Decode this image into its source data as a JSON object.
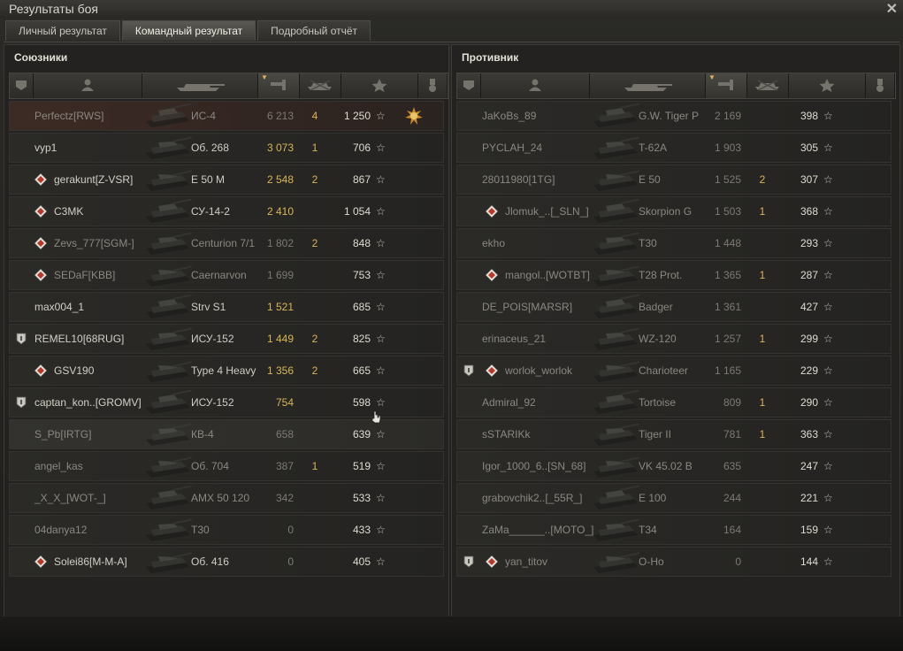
{
  "window": {
    "title": "Результаты боя"
  },
  "tabs": [
    {
      "label": "Личный результат",
      "active": false
    },
    {
      "label": "Командный результат",
      "active": true
    },
    {
      "label": "Подробный отчёт",
      "active": false
    }
  ],
  "icons": {
    "close": "close-icon",
    "header": [
      "platoon-icon",
      "player-icon",
      "tank-icon",
      "damage-icon",
      "kills-icon",
      "xp-icon",
      "medal-icon"
    ]
  },
  "colors": {
    "damage_highlight": "#d8b557",
    "self_row": "#3d2a24",
    "background": "#232220"
  },
  "allies": {
    "title": "Союзники",
    "rows": [
      {
        "name": "Perfectz[RWS]",
        "tank": "ИС-4",
        "damage": "6 213",
        "dmg_hi": false,
        "kills": "4",
        "xp": "1 250",
        "self": true,
        "dead": true,
        "platoon": false,
        "clan": false,
        "medal": true
      },
      {
        "name": "vyp1",
        "tank": "Об. 268",
        "damage": "3 073",
        "dmg_hi": true,
        "kills": "1",
        "xp": "706",
        "platoon": false,
        "clan": false
      },
      {
        "name": "gerakunt[Z-VSR]",
        "tank": "E 50 M",
        "damage": "2 548",
        "dmg_hi": true,
        "kills": "2",
        "xp": "867",
        "platoon": false,
        "clan": true
      },
      {
        "name": "C3MK",
        "tank": "СУ-14-2",
        "damage": "2 410",
        "dmg_hi": true,
        "kills": "",
        "xp": "1 054",
        "platoon": false,
        "clan": true
      },
      {
        "name": "Zevs_777[SGM-]",
        "tank": "Centurion 7/1",
        "damage": "1 802",
        "dmg_hi": false,
        "kills": "2",
        "xp": "848",
        "dead": true,
        "platoon": false,
        "clan": true
      },
      {
        "name": "SEDaF[KBB]",
        "tank": "Caernarvon",
        "damage": "1 699",
        "dmg_hi": false,
        "kills": "",
        "xp": "753",
        "dead": true,
        "platoon": false,
        "clan": true
      },
      {
        "name": "max004_1",
        "tank": "Strv S1",
        "damage": "1 521",
        "dmg_hi": true,
        "kills": "",
        "xp": "685",
        "platoon": false,
        "clan": false
      },
      {
        "name": "REMEL10[68RUG]",
        "tank": "ИСУ-152",
        "damage": "1 449",
        "dmg_hi": true,
        "kills": "2",
        "xp": "825",
        "platoon": true,
        "clan": false
      },
      {
        "name": "GSV190",
        "tank": "Type 4 Heavy",
        "damage": "1 356",
        "dmg_hi": true,
        "kills": "2",
        "xp": "665",
        "platoon": false,
        "clan": true
      },
      {
        "name": "captan_kon..[GROMV]",
        "tank": "ИСУ-152",
        "damage": "754",
        "dmg_hi": true,
        "kills": "",
        "xp": "598",
        "platoon": true,
        "clan": false
      },
      {
        "name": "S_Pb[IRTG]",
        "tank": "КВ-4",
        "damage": "658",
        "dmg_hi": false,
        "kills": "",
        "xp": "639",
        "dead": true,
        "hover": true,
        "platoon": false,
        "clan": false
      },
      {
        "name": "angel_kas",
        "tank": "Об. 704",
        "damage": "387",
        "dmg_hi": false,
        "kills": "1",
        "xp": "519",
        "dead": true,
        "platoon": false,
        "clan": false
      },
      {
        "name": "_X_X_[WOT-_]",
        "tank": "AMX 50 120",
        "damage": "342",
        "dmg_hi": false,
        "kills": "",
        "xp": "533",
        "dead": true,
        "platoon": false,
        "clan": false
      },
      {
        "name": "04danya12",
        "tank": "T30",
        "damage": "0",
        "dmg_hi": false,
        "kills": "",
        "xp": "433",
        "dead": true,
        "platoon": false,
        "clan": false
      },
      {
        "name": "Solei86[M-M-A]",
        "tank": "Об. 416",
        "damage": "0",
        "dmg_hi": false,
        "kills": "",
        "xp": "405",
        "platoon": false,
        "clan": true
      }
    ]
  },
  "enemies": {
    "title": "Противник",
    "rows": [
      {
        "name": "JaKoBs_89",
        "tank": "G.W. Tiger P",
        "damage": "2 169",
        "dmg_hi": false,
        "kills": "",
        "xp": "398",
        "dead": true,
        "platoon": false,
        "clan": false
      },
      {
        "name": "PYCLAH_24",
        "tank": "T-62A",
        "damage": "1 903",
        "dmg_hi": false,
        "kills": "",
        "xp": "305",
        "dead": true,
        "platoon": false,
        "clan": false
      },
      {
        "name": "28011980[1TG]",
        "tank": "E 50",
        "damage": "1 525",
        "dmg_hi": false,
        "kills": "2",
        "xp": "307",
        "dead": true,
        "platoon": false,
        "clan": false
      },
      {
        "name": "Jlomuk_..[_SLN_]",
        "tank": "Skorpion G",
        "damage": "1 503",
        "dmg_hi": false,
        "kills": "1",
        "xp": "368",
        "dead": true,
        "platoon": false,
        "clan": true
      },
      {
        "name": "ekho",
        "tank": "T30",
        "damage": "1 448",
        "dmg_hi": false,
        "kills": "",
        "xp": "293",
        "dead": true,
        "platoon": false,
        "clan": false
      },
      {
        "name": "mangol..[WOTBT]",
        "tank": "T28 Prot.",
        "damage": "1 365",
        "dmg_hi": false,
        "kills": "1",
        "xp": "287",
        "dead": true,
        "platoon": false,
        "clan": true
      },
      {
        "name": "DE_POIS[MARSR]",
        "tank": "Badger",
        "damage": "1 361",
        "dmg_hi": false,
        "kills": "",
        "xp": "427",
        "dead": true,
        "platoon": false,
        "clan": false
      },
      {
        "name": "erinaceus_21",
        "tank": "WZ-120",
        "damage": "1 257",
        "dmg_hi": false,
        "kills": "1",
        "xp": "299",
        "dead": true,
        "platoon": false,
        "clan": false
      },
      {
        "name": "worlok_worlok",
        "tank": "Charioteer",
        "damage": "1 165",
        "dmg_hi": false,
        "kills": "",
        "xp": "229",
        "dead": true,
        "platoon": true,
        "clan": true
      },
      {
        "name": "Admiral_92",
        "tank": "Tortoise",
        "damage": "809",
        "dmg_hi": false,
        "kills": "1",
        "xp": "290",
        "dead": true,
        "platoon": false,
        "clan": false
      },
      {
        "name": "sSTARIKk",
        "tank": "Tiger II",
        "damage": "781",
        "dmg_hi": false,
        "kills": "1",
        "xp": "363",
        "dead": true,
        "platoon": false,
        "clan": false
      },
      {
        "name": "Igor_1000_6..[SN_68]",
        "tank": "VK 45.02 B",
        "damage": "635",
        "dmg_hi": false,
        "kills": "",
        "xp": "247",
        "dead": true,
        "platoon": false,
        "clan": false
      },
      {
        "name": "grabovchik2..[_55R_]",
        "tank": "E 100",
        "damage": "244",
        "dmg_hi": false,
        "kills": "",
        "xp": "221",
        "dead": true,
        "platoon": false,
        "clan": false
      },
      {
        "name": "ZaMa______..[MOTO_]",
        "tank": "T34",
        "damage": "164",
        "dmg_hi": false,
        "kills": "",
        "xp": "159",
        "dead": true,
        "platoon": false,
        "clan": false
      },
      {
        "name": "yan_titov",
        "tank": "O-Ho",
        "damage": "0",
        "dmg_hi": false,
        "kills": "",
        "xp": "144",
        "dead": true,
        "platoon": true,
        "clan": true
      }
    ]
  }
}
